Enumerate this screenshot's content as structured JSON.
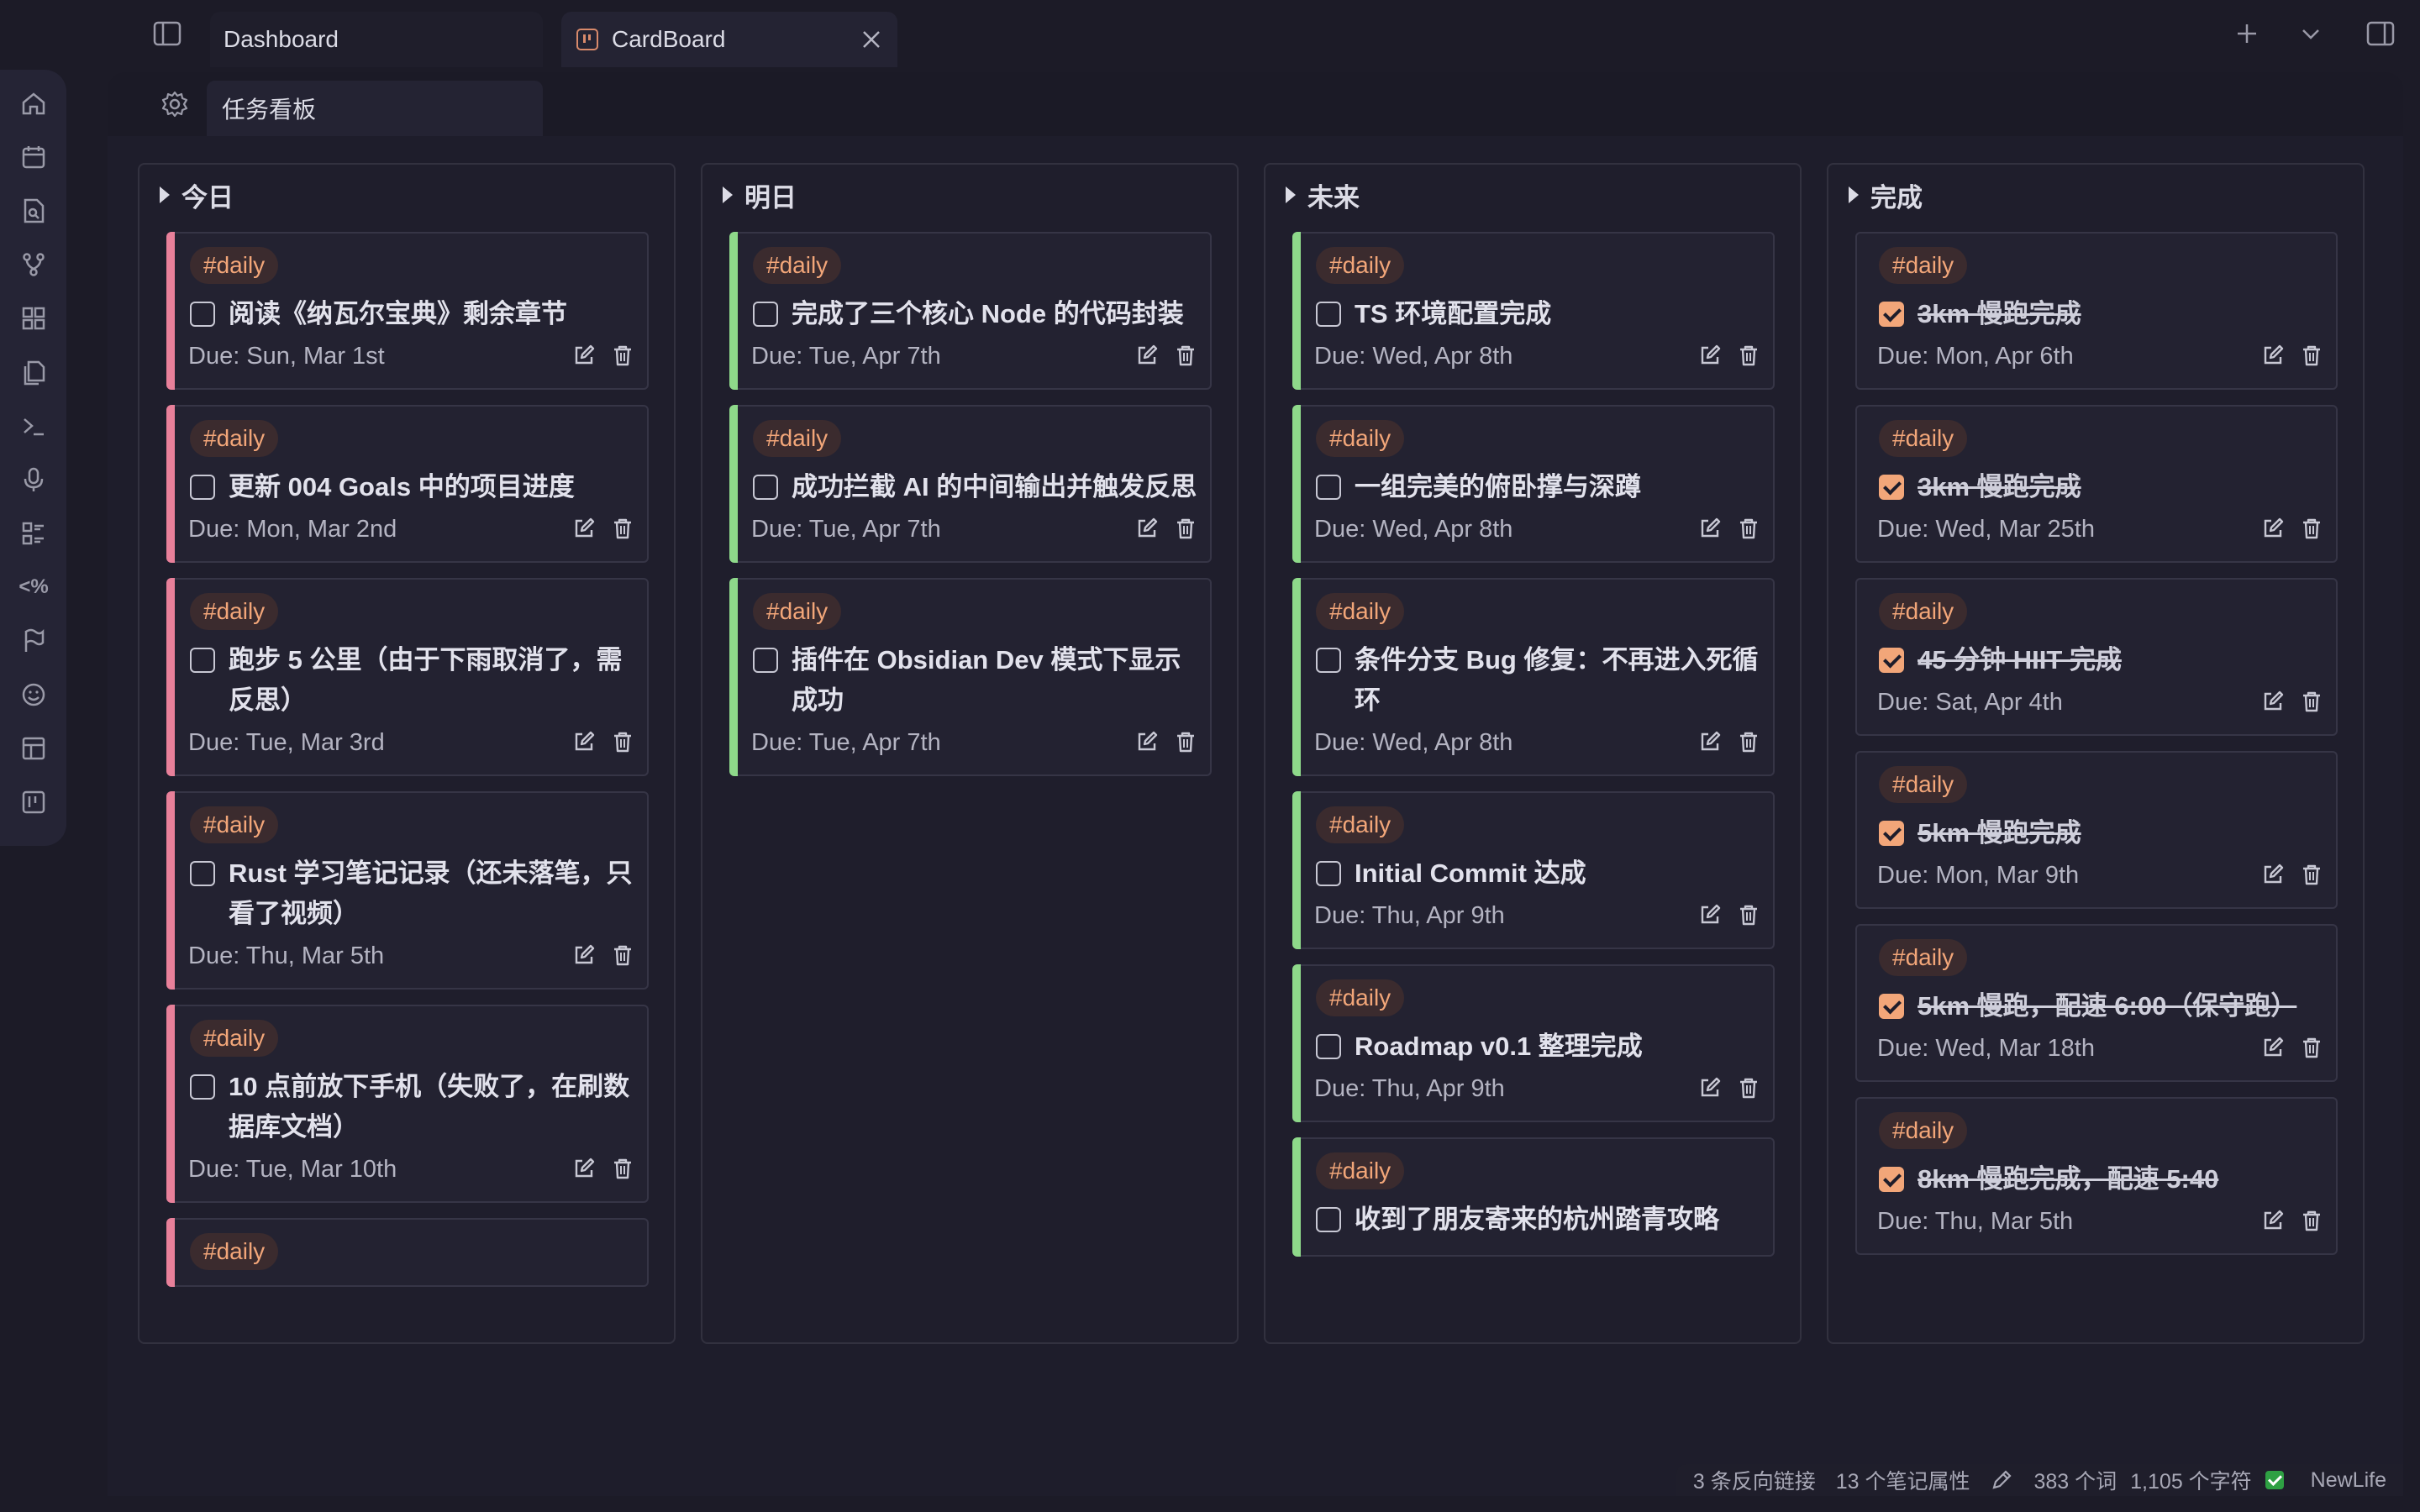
{
  "tabs": [
    {
      "label": "Dashboard"
    },
    {
      "label": "CardBoard"
    }
  ],
  "view_tab": {
    "label": "任务看板"
  },
  "ribbon_icons": [
    "home-icon",
    "calendar-icon",
    "file-search-icon",
    "graph-icon",
    "blocks-icon",
    "files-icon",
    "terminal-icon",
    "microphone-icon",
    "list-icon",
    "template-icon",
    "flag-icon",
    "smiley-icon",
    "layout-icon",
    "kanban-icon"
  ],
  "columns": [
    {
      "title": "今日",
      "accent": "#e8809a",
      "cards": [
        {
          "tag": "#daily",
          "text": "阅读《纳瓦尔宝典》剩余章节",
          "due": "Due: Sun, Mar 1st",
          "done": false
        },
        {
          "tag": "#daily",
          "text": "更新 004 Goals 中的项目进度",
          "due": "Due: Mon, Mar 2nd",
          "done": false
        },
        {
          "tag": "#daily",
          "text": "跑步 5 公里（由于下雨取消了，需反思）",
          "due": "Due: Tue, Mar 3rd",
          "done": false
        },
        {
          "tag": "#daily",
          "text": "Rust 学习笔记记录（还未落笔，只看了视频）",
          "due": "Due: Thu, Mar 5th",
          "done": false
        },
        {
          "tag": "#daily",
          "text": "10 点前放下手机（失败了，在刷数据库文档）",
          "due": "Due: Tue, Mar 10th",
          "done": false
        },
        {
          "tag": "#daily",
          "text": "",
          "due": "",
          "done": false
        }
      ]
    },
    {
      "title": "明日",
      "accent": "#8ed98a",
      "cards": [
        {
          "tag": "#daily",
          "text": "完成了三个核心 Node 的代码封装",
          "due": "Due: Tue, Apr 7th",
          "done": false
        },
        {
          "tag": "#daily",
          "text": "成功拦截 AI 的中间输出并触发反思",
          "due": "Due: Tue, Apr 7th",
          "done": false
        },
        {
          "tag": "#daily",
          "text": "插件在 Obsidian Dev 模式下显示成功",
          "due": "Due: Tue, Apr 7th",
          "done": false
        }
      ]
    },
    {
      "title": "未来",
      "accent": "#8ed98a",
      "cards": [
        {
          "tag": "#daily",
          "text": "TS 环境配置完成",
          "due": "Due: Wed, Apr 8th",
          "done": false
        },
        {
          "tag": "#daily",
          "text": "一组完美的俯卧撑与深蹲",
          "due": "Due: Wed, Apr 8th",
          "done": false
        },
        {
          "tag": "#daily",
          "text": "条件分支 Bug 修复：不再进入死循环",
          "due": "Due: Wed, Apr 8th",
          "done": false
        },
        {
          "tag": "#daily",
          "text": "Initial Commit 达成",
          "due": "Due: Thu, Apr 9th",
          "done": false
        },
        {
          "tag": "#daily",
          "text": "Roadmap v0.1 整理完成",
          "due": "Due: Thu, Apr 9th",
          "done": false
        },
        {
          "tag": "#daily",
          "text": "收到了朋友寄来的杭州踏青攻略",
          "due": "",
          "done": false
        }
      ]
    },
    {
      "title": "完成",
      "accent": "",
      "cards": [
        {
          "tag": "#daily",
          "text": "3km 慢跑完成",
          "due": "Due: Mon, Apr 6th",
          "done": true
        },
        {
          "tag": "#daily",
          "text": "3km 慢跑完成",
          "due": "Due: Wed, Mar 25th",
          "done": true
        },
        {
          "tag": "#daily",
          "text": "45 分钟 HIIT 完成",
          "due": "Due: Sat, Apr 4th",
          "done": true
        },
        {
          "tag": "#daily",
          "text": "5km 慢跑完成",
          "due": "Due: Mon, Mar 9th",
          "done": true
        },
        {
          "tag": "#daily",
          "text": "5km 慢跑，配速 6:00（保守跑）",
          "due": "Due: Wed, Mar 18th",
          "done": true
        },
        {
          "tag": "#daily",
          "text": "8km 慢跑完成，配速 5:40",
          "due": "Due: Thu, Mar 5th",
          "done": true
        }
      ]
    }
  ],
  "status_bar": {
    "backlinks": "3 条反向链接",
    "properties": "13 个笔记属性",
    "words": "383 个词",
    "chars": "1,105 个字符",
    "plugin": "NewLife"
  },
  "colors": {
    "tag_text": "#f2a679",
    "tag_bg": "#3b2b2e",
    "today_accent": "#e8809a",
    "future_accent": "#8ed98a"
  }
}
